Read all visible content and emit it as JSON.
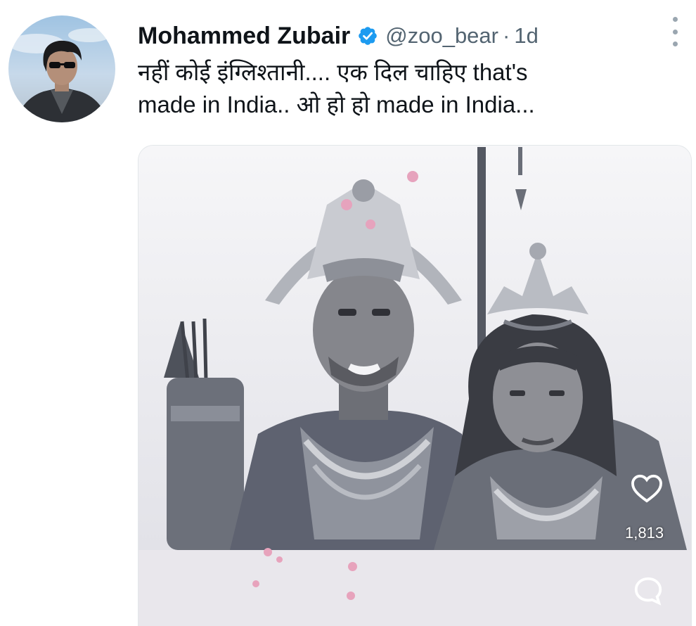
{
  "author": {
    "display_name": "Mohammed Zubair",
    "handle": "@zoo_bear",
    "separator": "·",
    "time_ago": "1d",
    "avatar_icon": "user-avatar",
    "verified_icon": "verified-badge-icon"
  },
  "tweet": {
    "text_lines": [
      "नहीं कोई इंग्लिश्तानी.... एक दिल चाहिए that's",
      "made in India.. ओ हो हो made in India..."
    ]
  },
  "media": {
    "like_count": "1,813",
    "like_icon": "heart-icon",
    "comment_icon": "comment-icon"
  },
  "colors": {
    "text": "#0f1419",
    "secondary": "#536471",
    "verified": "#1d9bf0",
    "footer_bg": "#e9e7ec"
  }
}
